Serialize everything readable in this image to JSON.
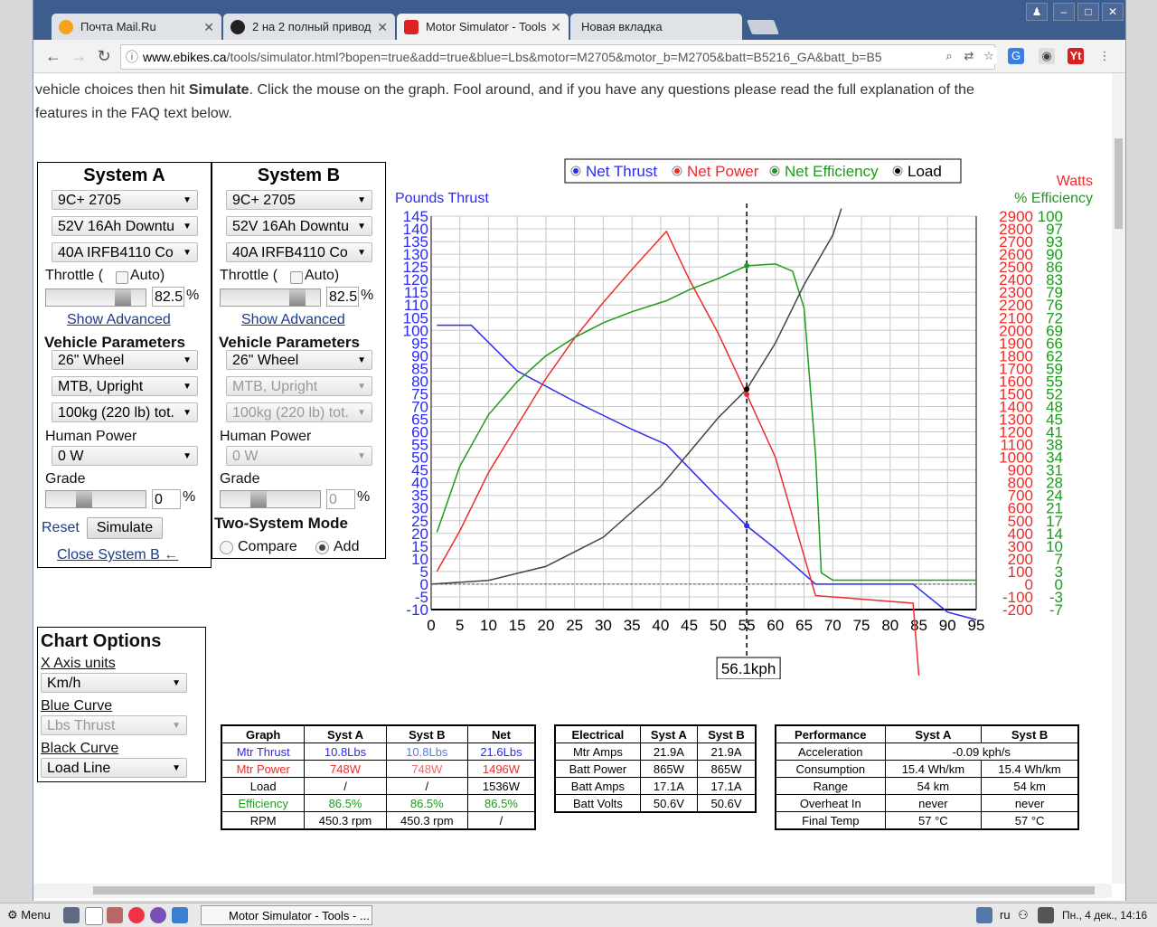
{
  "browser": {
    "tabs": [
      {
        "title": "Почта Mail.Ru",
        "icon": "mailru-icon"
      },
      {
        "title": "2 на 2 полный привод",
        "icon": "wheel-icon"
      },
      {
        "title": "Motor Simulator - Tools",
        "icon": "ebikes-icon"
      },
      {
        "title": "Новая вкладка",
        "icon": ""
      }
    ],
    "url_domain": "www.ebikes.ca",
    "url_path": "/tools/simulator.html?bopen=true&add=true&blue=Lbs&motor=M2705&motor_b=M2705&batt=B5216_GA&batt_b=B5"
  },
  "page": {
    "intro_line1_pre": "vehicle choices then hit ",
    "intro_line1_bold": "Simulate",
    "intro_line1_post": ". Click the mouse on the graph. Fool around, and if you have any questions please read the full explanation of the",
    "intro_line2": "features in the FAQ text below."
  },
  "systemA": {
    "title": "System A",
    "motor": "9C+ 2705",
    "battery": "52V 16Ah Downtu",
    "controller": "40A IRFB4110 Co",
    "throttle_label": "Throttle (",
    "auto_label": "Auto)",
    "throttle_value": "82.5",
    "throttle_fraction": 0.825,
    "percent": "%",
    "show_advanced": "Show Advanced",
    "vehicle_params": "Vehicle Parameters",
    "wheel": "26\"  Wheel",
    "frame": "MTB, Upright",
    "weight": "100kg (220 lb) tot.",
    "human_power_label": "Human Power",
    "human_power": "0 W",
    "grade_label": "Grade",
    "grade_value": "0",
    "reset": "Reset",
    "simulate": "Simulate",
    "close_b": "Close System B ←"
  },
  "systemB": {
    "title": "System B",
    "motor": "9C+ 2705",
    "battery": "52V 16Ah Downtu",
    "controller": "40A IRFB4110 Co",
    "throttle_label": "Throttle (",
    "auto_label": "Auto)",
    "throttle_value": "82.5",
    "throttle_fraction": 0.825,
    "percent": "%",
    "show_advanced": "Show Advanced",
    "vehicle_params": "Vehicle Parameters",
    "wheel": "26\"  Wheel",
    "frame": "MTB, Upright",
    "weight": "100kg (220 lb) tot.",
    "human_power_label": "Human Power",
    "human_power": "0 W",
    "grade_label": "Grade",
    "grade_value": "0",
    "two_system": "Two-System Mode",
    "compare": "Compare",
    "add": "Add"
  },
  "chart_options": {
    "title": "Chart Options",
    "x_axis_label": "X Axis units",
    "x_axis_value": "Km/h",
    "blue_label": "Blue Curve",
    "blue_value": "Lbs Thrust",
    "black_label": "Black Curve",
    "black_value": "Load Line"
  },
  "chart_data": {
    "type": "line",
    "legend": [
      "Net Thrust",
      "Net Power",
      "Net Efficiency",
      "Load"
    ],
    "legend_position": "top",
    "left_axis_label": "Pounds Thrust",
    "right_axis_label_1": "Watts",
    "right_axis_label_2": "% Efficiency",
    "x_ticks": [
      0,
      5,
      10,
      15,
      20,
      25,
      30,
      35,
      40,
      45,
      50,
      55,
      60,
      65,
      70,
      75,
      80,
      85,
      90,
      95
    ],
    "thrust_ticks": [
      145,
      140,
      135,
      130,
      125,
      120,
      115,
      110,
      105,
      100,
      95,
      90,
      85,
      80,
      75,
      70,
      65,
      60,
      55,
      50,
      45,
      40,
      35,
      30,
      25,
      20,
      15,
      10,
      5,
      0,
      -5,
      -10
    ],
    "watts_ticks": [
      2900,
      2800,
      2700,
      2600,
      2500,
      2400,
      2300,
      2200,
      2100,
      2000,
      1900,
      1800,
      1700,
      1600,
      1500,
      1400,
      1300,
      1200,
      1100,
      1000,
      900,
      800,
      700,
      600,
      500,
      400,
      300,
      200,
      100,
      0,
      -100,
      -200
    ],
    "eff_ticks": [
      100,
      97,
      93,
      90,
      86,
      83,
      79,
      76,
      72,
      69,
      66,
      62,
      59,
      55,
      52,
      48,
      45,
      41,
      38,
      34,
      31,
      28,
      24,
      21,
      17,
      14,
      10,
      7,
      3,
      0,
      -3,
      -7
    ],
    "xlim": [
      0,
      95
    ],
    "ylim_thrust": [
      -10,
      145
    ],
    "ylim_watts": [
      -200,
      2900
    ],
    "grid": true,
    "cursor_x": 55,
    "cursor_label": "56.1kph",
    "series": [
      {
        "name": "Net Thrust",
        "color": "#2a2af0",
        "axis": "thrust",
        "x": [
          1,
          7,
          15,
          25,
          35,
          41,
          50,
          55,
          60,
          67,
          80,
          84,
          90,
          95
        ],
        "y": [
          102,
          102,
          84,
          72,
          61,
          55,
          34,
          23,
          14,
          0,
          0,
          0,
          -11,
          -14
        ]
      },
      {
        "name": "Net Power",
        "color": "#f02a2a",
        "axis": "watts",
        "x": [
          1,
          5,
          10,
          15,
          20,
          25,
          30,
          35,
          41,
          45,
          50,
          55,
          60,
          67,
          70,
          84,
          85
        ],
        "y": [
          100,
          420,
          880,
          1250,
          1620,
          1940,
          2220,
          2480,
          2780,
          2400,
          1980,
          1496,
          1000,
          -90,
          -100,
          -150,
          -720
        ]
      },
      {
        "name": "Net Efficiency",
        "color": "#1e9a1e",
        "axis": "eff",
        "x": [
          1,
          5,
          10,
          15,
          20,
          25,
          30,
          35,
          41,
          45,
          50,
          55,
          60,
          63,
          65,
          67,
          68,
          70,
          95
        ],
        "y": [
          14,
          32,
          46,
          55,
          62,
          67,
          71,
          74,
          77,
          80,
          83,
          86.5,
          87,
          85,
          75,
          35,
          3,
          1,
          1
        ]
      },
      {
        "name": "Load",
        "color": "#444444",
        "axis": "watts",
        "x": [
          0,
          10,
          20,
          30,
          40,
          45,
          50,
          55,
          60,
          65,
          70,
          71.5
        ],
        "y": [
          0,
          30,
          140,
          370,
          770,
          1040,
          1310,
          1536,
          1900,
          2360,
          2750,
          2960
        ]
      }
    ]
  },
  "tables": {
    "graph": {
      "header": [
        "Graph",
        "Syst A",
        "Syst B",
        "Net"
      ],
      "rows": [
        [
          "Mtr Thrust",
          "10.8Lbs",
          "10.8Lbs",
          "21.6Lbs"
        ],
        [
          "Mtr Power",
          "748W",
          "748W",
          "1496W"
        ],
        [
          "Load",
          "/",
          "/",
          "1536W"
        ],
        [
          "Efficiency",
          "86.5%",
          "86.5%",
          "86.5%"
        ],
        [
          "RPM",
          "450.3 rpm",
          "450.3 rpm",
          "/"
        ]
      ]
    },
    "electrical": {
      "header": [
        "Electrical",
        "Syst A",
        "Syst B"
      ],
      "rows": [
        [
          "Mtr Amps",
          "21.9A",
          "21.9A"
        ],
        [
          "Batt Power",
          "865W",
          "865W"
        ],
        [
          "Batt Amps",
          "17.1A",
          "17.1A"
        ],
        [
          "Batt Volts",
          "50.6V",
          "50.6V"
        ]
      ]
    },
    "performance": {
      "header": [
        "Performance",
        "Syst A",
        "Syst B"
      ],
      "acceleration_label": "Acceleration",
      "acceleration": "-0.09 kph/s",
      "rows": [
        [
          "Consumption",
          "15.4 Wh/km",
          "15.4 Wh/km"
        ],
        [
          "Range",
          "54 km",
          "54 km"
        ],
        [
          "Overheat In",
          "never",
          "never"
        ],
        [
          "Final Temp",
          "57 °C",
          "57 °C"
        ]
      ]
    }
  },
  "taskbar": {
    "menu": "Menu",
    "window": "Motor Simulator - Tools - ...",
    "lang": "ru",
    "clock": "Пн., 4 дек., 14:16"
  },
  "colors": {
    "thrust": "#2a2af0",
    "power": "#f02a2a",
    "eff": "#1e9a1e",
    "load": "#444444",
    "tab_bar": "#3d5d8f"
  }
}
